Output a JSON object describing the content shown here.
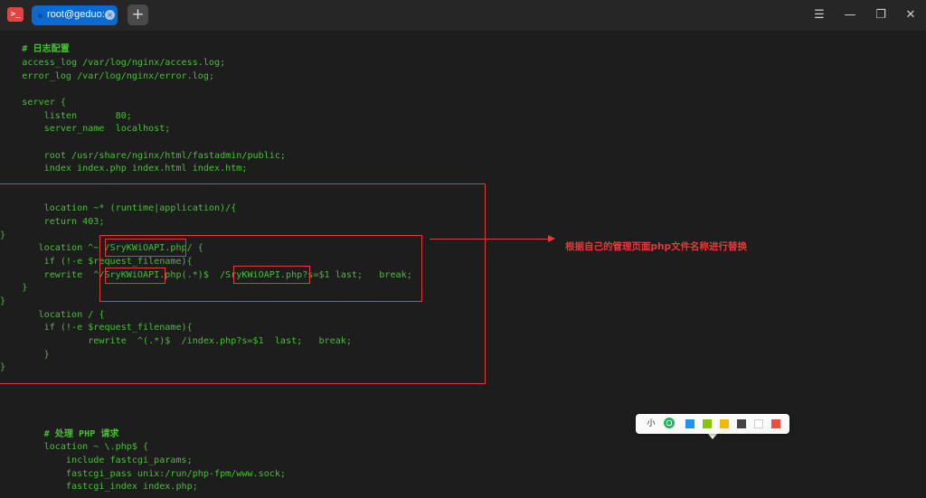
{
  "window": {
    "tab_title": "root@geduo:~",
    "tab_close_glyph": "×",
    "new_tab_glyph": "+",
    "app_icon_glyph": ">_",
    "menu_glyph": "☰",
    "minimize_glyph": "—",
    "maximize_glyph": "❐",
    "close_glyph": "✕"
  },
  "terminal": {
    "lines": [
      "    # 日志配置",
      "    access_log /var/log/nginx/access.log;",
      "    error_log /var/log/nginx/error.log;",
      "",
      "    server {",
      "        listen       80;",
      "        server_name  localhost;",
      "",
      "        root /usr/share/nginx/html/fastadmin/public;",
      "        index index.php index.html index.htm;",
      "",
      "",
      "        location ~* (runtime|application)/{",
      "        return 403;",
      "}",
      "       location ^~ /SryKWiOAPI.php/ {",
      "        if (!-e $request_filename){",
      "        rewrite  ^/SryKWiOAPI.php(.*)$  /SryKWiOAPI.php?s=$1 last;   break;",
      "    }",
      "}",
      "       location / {",
      "        if (!-e $request_filename){",
      "                rewrite  ^(.*)$  /index.php?s=$1  last;   break;",
      "        }",
      "}",
      "",
      "",
      "",
      "",
      "        # 处理 PHP 请求",
      "        location ~ \\.php$ {",
      "            include fastcgi_params;",
      "            fastcgi_pass unix:/run/php-fpm/www.sock;",
      "            fastcgi_index index.php;"
    ]
  },
  "annotation": {
    "note": "根据自己的管理页面php文件名称进行替换",
    "color": "#e03a3a"
  },
  "toolbar": {
    "size_label": "小",
    "swatches": [
      {
        "name": "green-swatch",
        "color": "#1eb858"
      },
      {
        "name": "blue-swatch",
        "color": "#1e96f0"
      },
      {
        "name": "lime-swatch",
        "color": "#88c40a"
      },
      {
        "name": "yellow-swatch",
        "color": "#f5b800"
      },
      {
        "name": "dark-gray-swatch",
        "color": "#444444"
      },
      {
        "name": "white-swatch",
        "color": "#ffffff"
      },
      {
        "name": "red-swatch",
        "color": "#ef4c43"
      }
    ]
  },
  "colors": {
    "terminal_bg": "#1d1d1d",
    "terminal_text": "#46c033",
    "tab_active": "#0a6ad1"
  }
}
